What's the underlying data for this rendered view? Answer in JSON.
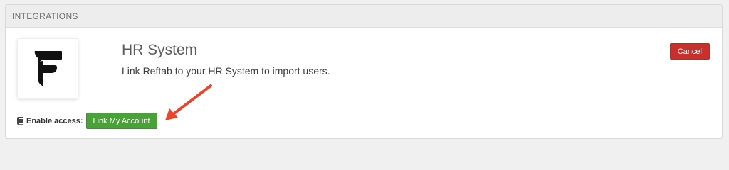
{
  "panel": {
    "header_title": "INTEGRATIONS"
  },
  "integration": {
    "logo_icon": "f-logo-icon",
    "title": "HR System",
    "description": "Link Reftab to your HR System to import users.",
    "cancel_label": "Cancel"
  },
  "access": {
    "icon": "book-icon",
    "label": "Enable access:",
    "link_button_label": "Link My Account"
  },
  "annotation": {
    "arrow_color": "#e8452c"
  },
  "colors": {
    "cancel": "#c9302c",
    "link": "#4aa137"
  }
}
